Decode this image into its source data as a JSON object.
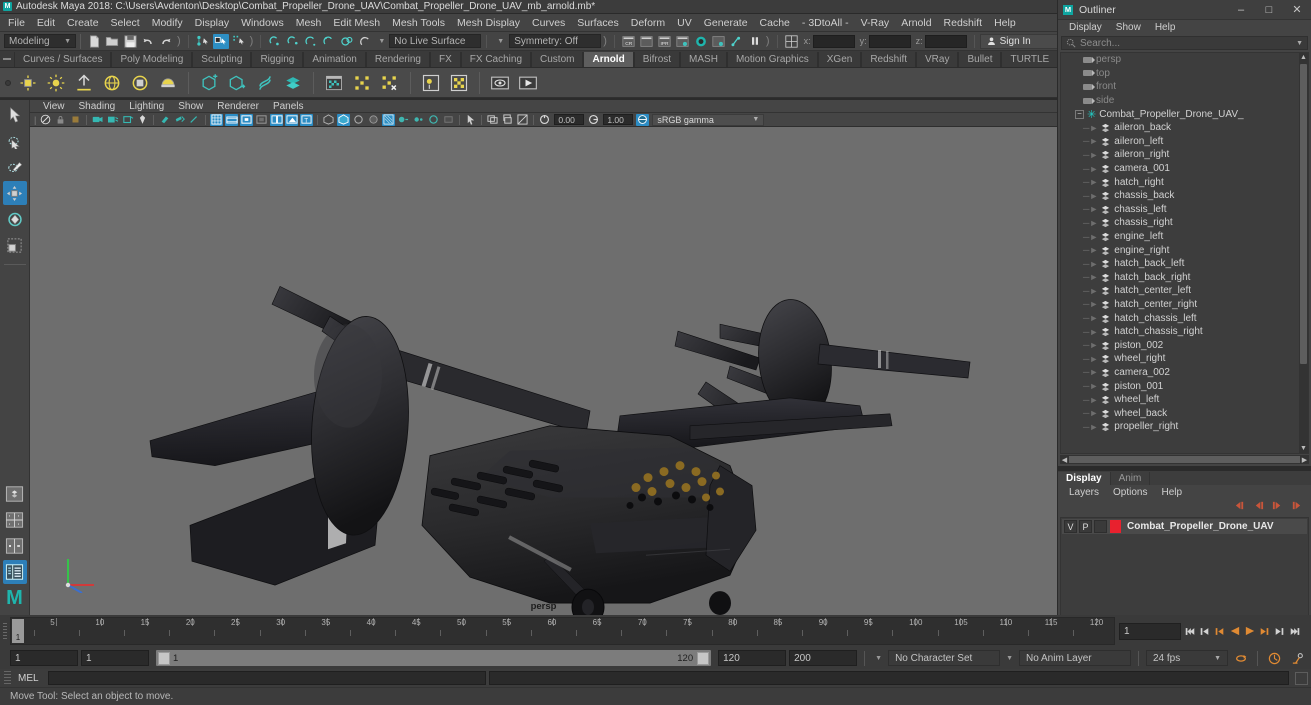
{
  "title_bar": {
    "logo": "maya-logo",
    "title": "Autodesk Maya 2018: C:\\Users\\Avdenton\\Desktop\\Combat_Propeller_Drone_UAV\\Combat_Propeller_Drone_UAV_mb_arnold.mb*"
  },
  "main_menu": [
    "File",
    "Edit",
    "Create",
    "Select",
    "Modify",
    "Display",
    "Windows",
    "Mesh",
    "Edit Mesh",
    "Mesh Tools",
    "Mesh Display",
    "Curves",
    "Surfaces",
    "Deform",
    "UV",
    "Generate",
    "Cache",
    "- 3DtoAll -",
    "V-Ray",
    "Arnold",
    "Redshift",
    "Help"
  ],
  "status_bar": {
    "menu_set": "Modeling",
    "live_surface": "No Live Surface",
    "symmetry": "Symmetry: Off",
    "axis_labels": [
      "x:",
      "y:",
      "z:"
    ],
    "axis_values": [
      "",
      "",
      ""
    ],
    "sign_in": "Sign In",
    "icons": [
      "new-scene-icon",
      "open-scene-icon",
      "save-scene-icon",
      "undo-icon",
      "redo-icon",
      "select-by-hierarchy-icon",
      "select-by-object-icon",
      "select-by-component-icon",
      "snap-to-grid-icon",
      "snap-to-curve-icon",
      "snap-to-point-icon",
      "snap-to-projected-center-icon",
      "snap-to-view-plane-icon",
      "make-live-icon",
      "render-current-frame-icon",
      "ipr-render-icon",
      "render-settings-icon",
      "hypershade-icon",
      "render-view-icon",
      "render-sequence-icon",
      "toggle-icon",
      "pause-icon",
      "editor-layout-icon"
    ]
  },
  "shelf_tabs": {
    "items": [
      "Curves / Surfaces",
      "Poly Modeling",
      "Sculpting",
      "Rigging",
      "Animation",
      "Rendering",
      "FX",
      "FX Caching",
      "Custom",
      "Arnold",
      "Bifrost",
      "MASH",
      "Motion Graphics",
      "XGen",
      "Redshift",
      "VRay",
      "Bullet",
      "TURTLE"
    ],
    "selected": "Arnold"
  },
  "shelf_icons": [
    "arnold-area-light-icon",
    "arnold-point-light-icon",
    "arnold-distant-light-icon",
    "arnold-skydome-light-icon",
    "arnold-mesh-light-icon",
    "arnold-photometric-light-icon",
    "arnold-standin-create-icon",
    "arnold-standin-export-icon",
    "arnold-volume-icon",
    "arnold-mesh-icon",
    "arnold-render-settings-icon",
    "arnold-flare-icon",
    "arnold-remove-icon",
    "arnold-light-manager-icon",
    "arnold-utility-icon",
    "arnold-render-view-icon",
    "arnold-render-sequence-icon"
  ],
  "toolbox": {
    "tools": [
      "select-tool-icon",
      "lasso-select-tool-icon",
      "paint-select-tool-icon",
      "move-tool-icon",
      "rotate-tool-icon",
      "scale-tool-icon"
    ],
    "selected": "move-tool-icon",
    "layouts": [
      "single-perspective-layout-icon",
      "four-view-layout-icon",
      "two-pane-side-layout-icon",
      "outliner-persp-layout-icon"
    ],
    "selected_layout": "outliner-persp-layout-icon",
    "maya_mark": "M"
  },
  "viewport": {
    "menus": [
      "View",
      "Shading",
      "Lighting",
      "Show",
      "Renderer",
      "Panels"
    ],
    "camera_label": "persp",
    "exposure_value": "0.00",
    "gamma_value": "1.00",
    "color_management": "sRGB gamma",
    "toolbar_icons": [
      "select-camera-icon",
      "lock-camera-icon",
      "camera-attributes-icon",
      "bookmark-icon",
      "image-plane-icon",
      "two-d-pan-zoom-icon",
      "grease-pencil-icon",
      "grid-icon",
      "film-gate-icon",
      "resolution-gate-icon",
      "gate-mask-icon",
      "wireframe-icon",
      "smooth-shade-all-icon",
      "textured-icon",
      "use-all-lights-icon",
      "shadows-icon",
      "screen-space-ao-icon",
      "motion-blur-icon",
      "multisample-aa-icon",
      "depth-of-field-icon",
      "isolate-select-icon",
      "xray-icon",
      "xray-joints-icon",
      "xray-active-components-icon",
      "exposure-icon",
      "gamma-icon",
      "color-management-icon"
    ],
    "scene_object": "Combat Propeller Drone UAV aircraft model"
  },
  "outliner": {
    "window_title": "Outliner",
    "window_buttons": [
      "minimize-icon",
      "maximize-icon",
      "close-icon"
    ],
    "menus": [
      "Display",
      "Show",
      "Help"
    ],
    "search_placeholder": "Search...",
    "group_node": "Combat_Propeller_Drone_UAV_",
    "cameras": [
      "persp",
      "top",
      "front",
      "side"
    ],
    "children": [
      "aileron_back",
      "aileron_left",
      "aileron_right",
      "camera_001",
      "hatch_right",
      "chassis_back",
      "chassis_left",
      "chassis_right",
      "engine_left",
      "engine_right",
      "hatch_back_left",
      "hatch_back_right",
      "hatch_center_left",
      "hatch_center_right",
      "hatch_chassis_left",
      "hatch_chassis_right",
      "piston_002",
      "wheel_right",
      "camera_002",
      "piston_001",
      "wheel_left",
      "wheel_back",
      "propeller_right"
    ]
  },
  "layer_editor": {
    "tabs": [
      "Display",
      "Anim"
    ],
    "selected_tab": "Display",
    "menus": [
      "Layers",
      "Options",
      "Help"
    ],
    "buttons": [
      "layer-first-icon",
      "layer-prev-icon",
      "layer-next-icon",
      "layer-last-icon"
    ],
    "layers": [
      {
        "visibility": "V",
        "playback": "P",
        "shading": "",
        "color": "#e8212e",
        "name": "Combat_Propeller_Drone_UAV"
      }
    ]
  },
  "timeline": {
    "ticks": [
      5,
      10,
      15,
      20,
      25,
      30,
      35,
      40,
      45,
      50,
      55,
      60,
      65,
      70,
      75,
      80,
      85,
      90,
      95,
      100,
      105,
      110,
      115,
      120
    ],
    "current_frame": "1",
    "frame_field": "1",
    "playback_buttons": [
      "go-to-start-icon",
      "step-back-keyframe-icon",
      "step-back-frame-icon",
      "play-backwards-icon",
      "play-forwards-icon",
      "step-forward-frame-icon",
      "step-forward-keyframe-icon",
      "go-to-end-icon"
    ]
  },
  "range_slider": {
    "anim_start": "1",
    "anim_end": "1",
    "range_start": "1",
    "range_end": "120",
    "playback_end": "120",
    "anim_total_end": "200",
    "character_set": "No Character Set",
    "anim_layer": "No Anim Layer",
    "fps": "24 fps",
    "right_icons": [
      "auto-key-icon",
      "animation-preferences-icon",
      "cycle-icon"
    ]
  },
  "command_line": {
    "label": "MEL",
    "input_value": "",
    "output_value": "",
    "script_editor_icon": "script-editor-icon"
  },
  "status_line": {
    "message": "Move Tool: Select an object to move."
  },
  "colors": {
    "accent_blue": "#2d8fc4",
    "accent_teal": "#1fb5ad",
    "layer_red": "#e8212e",
    "panel_bg": "#444444",
    "viewport_bg": "#6e6e6e",
    "orange": "#e08a33"
  }
}
